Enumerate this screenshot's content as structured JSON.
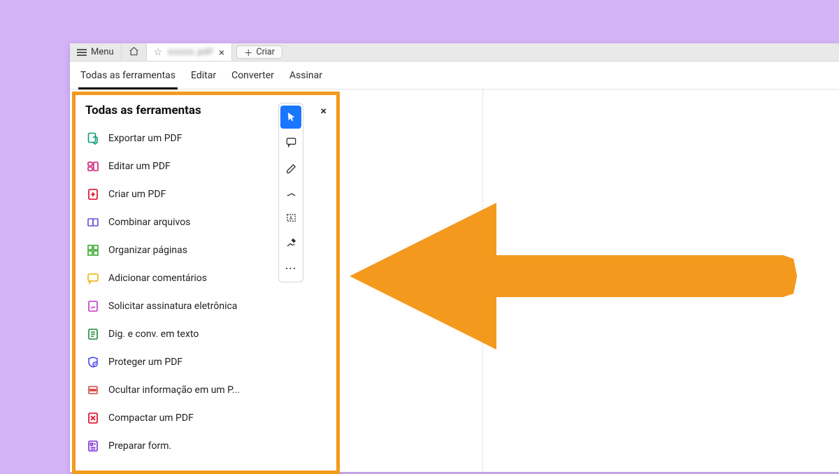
{
  "titlebar": {
    "menu_label": "Menu",
    "tab_name": "xxxxx.pdf",
    "criar_label": "Criar"
  },
  "subnav": {
    "items": [
      {
        "label": "Todas as ferramentas",
        "active": true
      },
      {
        "label": "Editar",
        "active": false
      },
      {
        "label": "Converter",
        "active": false
      },
      {
        "label": "Assinar",
        "active": false
      }
    ]
  },
  "panel": {
    "title": "Todas as ferramentas",
    "tools": [
      {
        "label": "Exportar um PDF",
        "icon": "export-pdf-icon",
        "color": "#0a9b7a"
      },
      {
        "label": "Editar um PDF",
        "icon": "edit-pdf-icon",
        "color": "#d11e7a"
      },
      {
        "label": "Criar um PDF",
        "icon": "create-pdf-icon",
        "color": "#e1001a"
      },
      {
        "label": "Combinar arquivos",
        "icon": "combine-icon",
        "color": "#6a4cd6"
      },
      {
        "label": "Organizar páginas",
        "icon": "organize-icon",
        "color": "#3aa82e"
      },
      {
        "label": "Adicionar comentários",
        "icon": "comment-icon",
        "color": "#e8b600"
      },
      {
        "label": "Solicitar assinatura eletrônica",
        "icon": "esign-icon",
        "color": "#c533c5"
      },
      {
        "label": "Dig. e conv. em texto",
        "icon": "ocr-icon",
        "color": "#1b8a3a"
      },
      {
        "label": "Proteger um PDF",
        "icon": "protect-icon",
        "color": "#4a4af0"
      },
      {
        "label": "Ocultar informação em um P...",
        "icon": "redact-icon",
        "color": "#d6453a"
      },
      {
        "label": "Compactar um PDF",
        "icon": "compress-icon",
        "color": "#e1001a"
      },
      {
        "label": "Preparar form.",
        "icon": "form-icon",
        "color": "#7a2ed6"
      }
    ]
  },
  "quickbar": {
    "items": [
      {
        "name": "cursor-tool",
        "selected": true
      },
      {
        "name": "comment-tool",
        "selected": false
      },
      {
        "name": "highlight-tool",
        "selected": false
      },
      {
        "name": "draw-tool",
        "selected": false
      },
      {
        "name": "text-select-tool",
        "selected": false
      },
      {
        "name": "sign-tool",
        "selected": false
      },
      {
        "name": "more-tool",
        "selected": false
      }
    ]
  },
  "highlight_color": "#f39a1e"
}
